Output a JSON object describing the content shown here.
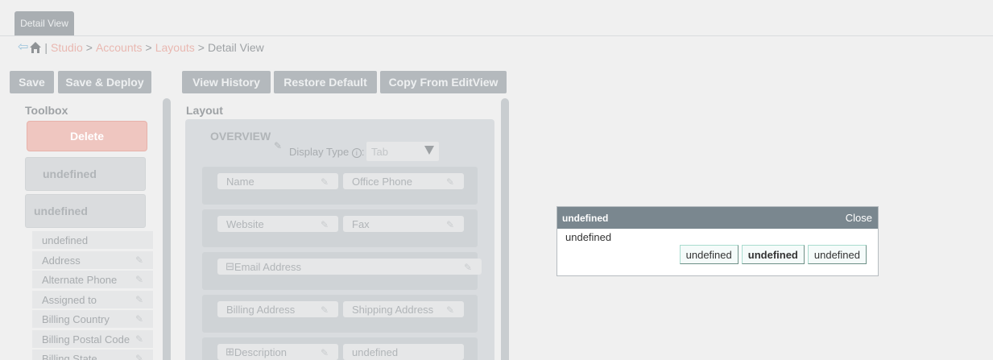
{
  "tab": {
    "label": "Detail View"
  },
  "breadcrumb": {
    "studio": "Studio",
    "accounts": "Accounts",
    "layouts": "Layouts",
    "current": "Detail View",
    "sep1": "|",
    "sep2": ">",
    "sep3": ">",
    "sep4": ">"
  },
  "toolbar": {
    "save": "Save",
    "save_deploy": "Save & Deploy",
    "view_history": "View History",
    "restore_default": "Restore Default",
    "copy_from_editview": "Copy From EditView"
  },
  "toolbox": {
    "title": "Toolbox",
    "delete": "Delete",
    "new_panel": "undefined",
    "new_row": "undefined",
    "filler": "undefined",
    "fields": [
      "Address",
      "Alternate Phone",
      "Assigned to",
      "Billing Country",
      "Billing Postal Code",
      "Billing State"
    ]
  },
  "layout": {
    "title": "Layout",
    "panel_name": "OVERVIEW",
    "display_type_label": "Display Type",
    "display_type_value": "Tab",
    "rows": [
      [
        "Name",
        "Office Phone"
      ],
      [
        "Website",
        "Fax"
      ],
      [
        "Email Address"
      ],
      [
        "Billing Address",
        "Shipping Address"
      ],
      [
        "Description",
        "undefined"
      ]
    ]
  },
  "dialog": {
    "title": "undefined",
    "close": "Close",
    "message": "undefined",
    "buttons": [
      "undefined",
      "undefined",
      "undefined"
    ]
  },
  "colors": {
    "dialog_header": "#7a878f",
    "button_border": "#a9dccf",
    "delete": "#efc6c0"
  }
}
